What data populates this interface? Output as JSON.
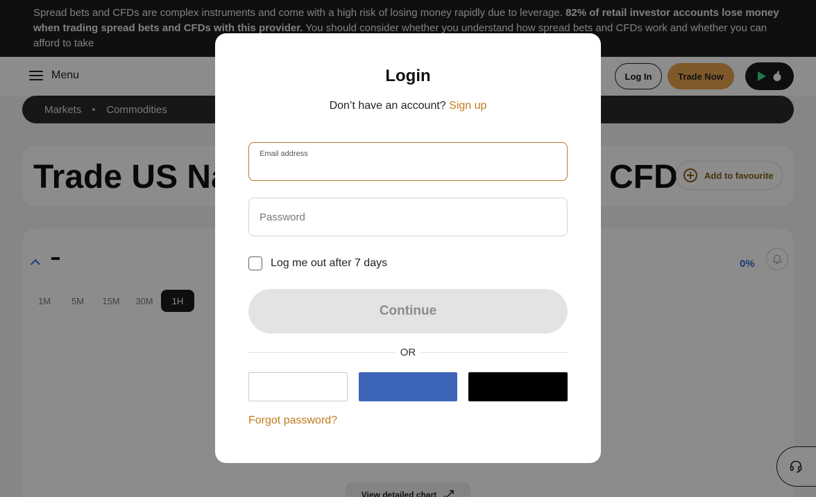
{
  "risk_banner": {
    "text_normal": "Spread bets and CFDs are complex instruments and come with a high risk of losing money rapidly due to leverage. ",
    "text_bold": "82% of retail investor accounts lose money when trading spread bets and CFDs with this provider.",
    "text_tail": " You should consider whether you understand how spread bets and CFDs work and whether you can afford to take"
  },
  "header": {
    "menu_label": "Menu",
    "login_label": "Log In",
    "trade_label": "Trade Now"
  },
  "breadcrumb": [
    "Markets",
    "Commodities"
  ],
  "title_card": {
    "title_left": "Trade US Na",
    "title_right": "CFD",
    "favourite_label": "Add to favourite"
  },
  "chart_card": {
    "change_pct": "0%",
    "timeframes": [
      "1M",
      "5M",
      "15M",
      "30M",
      "1H"
    ],
    "active_timeframe": "1H",
    "detail_label": "View detailed chart"
  },
  "modal": {
    "title": "Login",
    "signup_prompt": "Don’t have an account?",
    "signup_link": "Sign up",
    "email_label": "Email address",
    "email_value": "",
    "password_placeholder": "Password",
    "remember_label": "Log me out after 7 days",
    "continue_label": "Continue",
    "or_label": "OR",
    "forgot_label": "Forgot password?"
  },
  "colors": {
    "accent": "#c07a1e",
    "trade_button": "#e7a24b",
    "facebook": "#3c65b8",
    "apple": "#000000"
  },
  "icons": [
    "hamburger-icon",
    "google-play-icon",
    "apple-icon",
    "plus-circle-icon",
    "chevron-up-icon",
    "bell-icon",
    "expand-icon",
    "headset-icon"
  ]
}
